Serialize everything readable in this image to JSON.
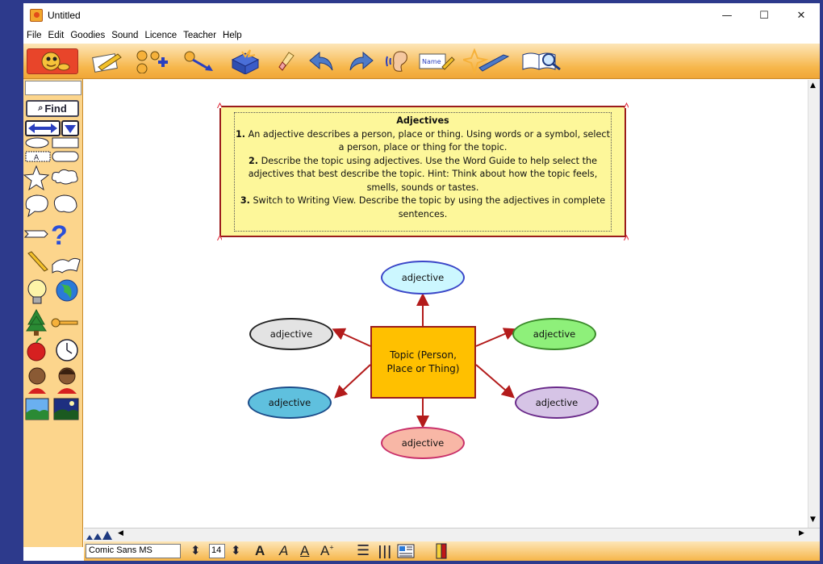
{
  "window": {
    "title": "Untitled",
    "controls": {
      "minimize": "—",
      "maximize": "☐",
      "close": "✕"
    }
  },
  "menu": [
    "File",
    "Edit",
    "Goodies",
    "Sound",
    "Licence",
    "Teacher",
    "Help"
  ],
  "toolbar": {
    "icons": [
      "mascot-icon",
      "pencil-writing-view-icon",
      "new-node-icon",
      "connector-icon",
      "explode-icon",
      "eraser-icon",
      "undo-icon",
      "redo-icon",
      "ear-listen-icon",
      "name-label-icon",
      "pen-star-icon",
      "book-magnifier-icon"
    ]
  },
  "left_panel": {
    "find_label": "Find",
    "shape_icons": [
      "oval-shape-icon",
      "rectangle-shape-icon",
      "text-box-icon",
      "star-shape-icon",
      "cloud-shape-icon",
      "speech-bubble-icon",
      "thought-bubble-icon",
      "question-icon",
      "pencil-icon",
      "book-icon",
      "lightbulb-icon",
      "globe-icon",
      "tree-icon",
      "key-icon",
      "apple-icon",
      "clock-icon",
      "boy-icon",
      "girl-icon",
      "landscape-day-icon",
      "landscape-night-icon"
    ]
  },
  "instructions": {
    "heading": "Adjectives",
    "n1": "1.",
    "s1": "An adjective describes a person, place or thing. Using words or a symbol, select a person, place or thing for the topic.",
    "n2": "2.",
    "s2": "Describe the topic using adjectives. Use the Word Guide to help select the adjectives that best describe the topic. Hint: Think about how the topic feels, smells, sounds or tastes.",
    "n3": "3.",
    "s3": "Switch to Writing View. Describe the topic by using the adjectives in complete sentences."
  },
  "diagram": {
    "topic": "Topic (Person, Place or Thing)",
    "nodes": [
      {
        "id": "top",
        "label": "adjective",
        "fill": "#ccf7ff",
        "stroke": "#3a46c8"
      },
      {
        "id": "left",
        "label": "adjective",
        "fill": "#e3e3e3",
        "stroke": "#222222"
      },
      {
        "id": "right",
        "label": "adjective",
        "fill": "#8ef07a",
        "stroke": "#3a8a2a"
      },
      {
        "id": "bottom-left",
        "label": "adjective",
        "fill": "#5fc0de",
        "stroke": "#1c4d8a"
      },
      {
        "id": "bottom-right",
        "label": "adjective",
        "fill": "#d6c4e6",
        "stroke": "#6a2a8a"
      },
      {
        "id": "bottom",
        "label": "adjective",
        "fill": "#f8b7a6",
        "stroke": "#c9306a"
      }
    ],
    "arrow_color": "#b31b1b"
  },
  "format_bar": {
    "font": "Comic Sans MS",
    "size": "14"
  }
}
